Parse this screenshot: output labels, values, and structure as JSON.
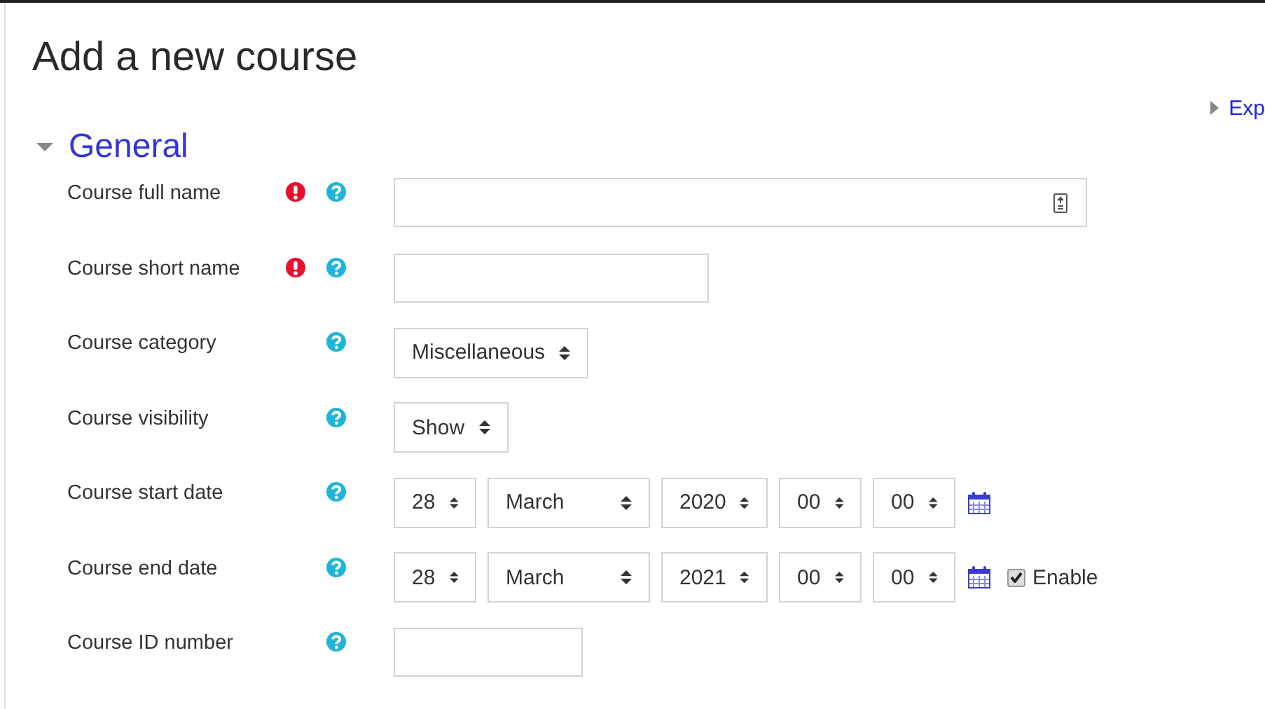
{
  "page_title": "Add a new course",
  "expand_link": "Exp",
  "section": {
    "title": "General",
    "expanded": true
  },
  "fields": [
    {
      "kind": "longtext",
      "label": "Course full name",
      "required": true,
      "value_icon": true
    },
    {
      "kind": "text",
      "label": "Course short name",
      "required": true
    },
    {
      "kind": "select",
      "label": "Course category",
      "required": false,
      "value": "Miscellaneous"
    },
    {
      "kind": "select",
      "label": "Course visibility",
      "required": false,
      "value": "Show"
    },
    {
      "kind": "date",
      "label": "Course start date",
      "required": false,
      "parts": [
        "28",
        "March",
        "2020",
        "00",
        "00"
      ]
    },
    {
      "kind": "date",
      "label": "Course end date",
      "required": false,
      "parts": [
        "28",
        "March",
        "2021",
        "00",
        "00"
      ],
      "enable": {
        "label": "Enable",
        "checked": true
      }
    },
    {
      "kind": "shorttext",
      "label": "Course ID number",
      "required": false
    }
  ]
}
